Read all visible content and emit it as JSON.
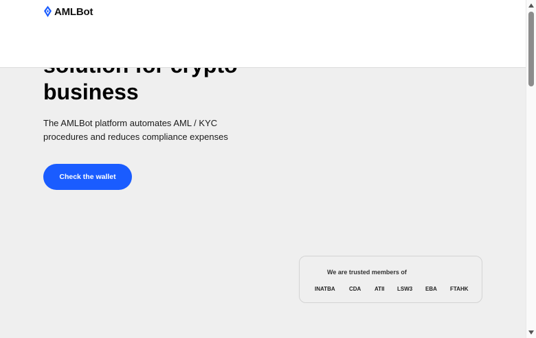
{
  "header": {
    "logo_text": "AMLBot"
  },
  "hero": {
    "title_line1": "solution for crypto",
    "title_line2": "business",
    "subtitle_line1": "The AMLBot platform automates AML / KYC",
    "subtitle_line2": "procedures and reduces compliance expenses",
    "cta_label": "Check the wallet"
  },
  "trust": {
    "title": "We are trusted members of",
    "members": [
      "INATBA",
      "CDA",
      "ATII",
      "LSW3",
      "EBA",
      "FTAHK"
    ]
  },
  "colors": {
    "accent": "#1a5cff",
    "background": "#efefef"
  },
  "icons": {
    "logo": "logo-icon",
    "scroll_up": "scroll-up-arrow-icon",
    "scroll_down": "scroll-down-arrow-icon"
  }
}
